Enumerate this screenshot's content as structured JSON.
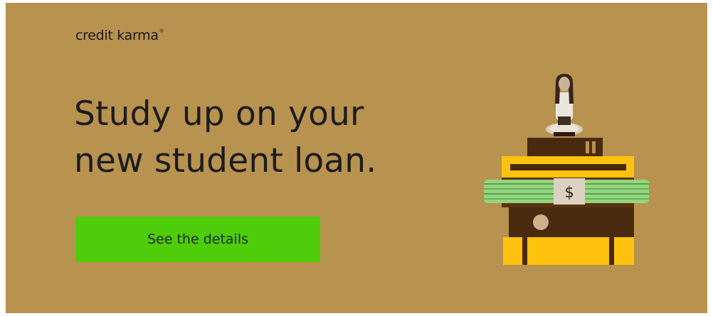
{
  "ad": {
    "brand": "credit karma",
    "headline_line1": "Study up on your",
    "headline_line2": "new student loan.",
    "cta_label": "See the details",
    "money_symbol": "$"
  },
  "colors": {
    "background": "#b8924f",
    "cta": "#4fcc0a",
    "book_yellow": "#ffc20e",
    "book_brown": "#5a3412",
    "cash_green": "#8fd27c"
  },
  "icons": [
    "dollar-icon"
  ]
}
